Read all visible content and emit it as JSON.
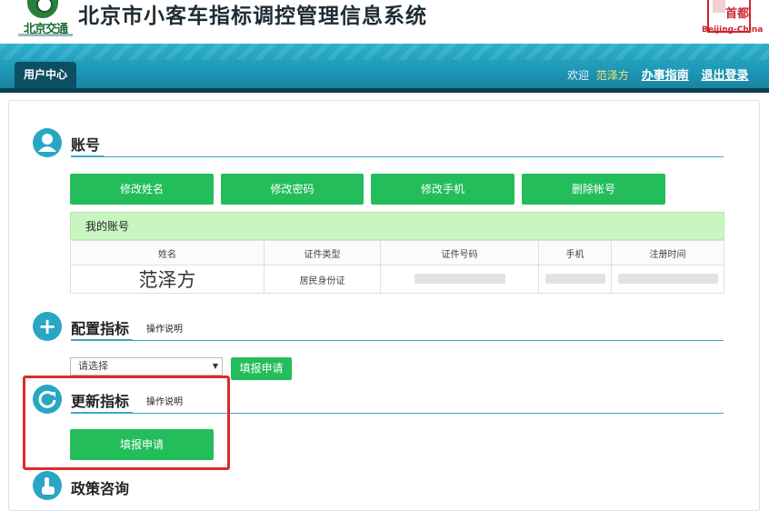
{
  "header": {
    "logo_text": "北京交通",
    "site_title": "北京市小客车指标调控管理信息系统",
    "seal_text": "首都",
    "seal_caption": "Beijing-China"
  },
  "nav": {
    "user_center": "用户中心",
    "welcome": "欢迎",
    "username": "范泽方",
    "guide_link": "办事指南",
    "logout_link": "退出登录"
  },
  "account": {
    "title": "账号",
    "buttons": [
      "修改姓名",
      "修改密码",
      "修改手机",
      "删除帐号"
    ],
    "table_caption": "我的账号",
    "columns": [
      "姓名",
      "证件类型",
      "证件号码",
      "手机",
      "注册时间"
    ],
    "row": {
      "name": "范泽方",
      "id_type": "居民身份证",
      "id_number": "",
      "phone": "",
      "register_time": ""
    }
  },
  "config_quota": {
    "title": "配置指标",
    "note": "操作说明",
    "select_value": "请选择",
    "apply_button": "填报申请"
  },
  "renew_quota": {
    "title": "更新指标",
    "note": "操作说明",
    "apply_button": "填报申请"
  },
  "policy": {
    "title": "政策咨询"
  },
  "colors": {
    "accent": "#29a6c4",
    "button_green": "#23bd5b",
    "highlight_red": "#e02a2a",
    "nav_dark": "#0c4f63"
  }
}
